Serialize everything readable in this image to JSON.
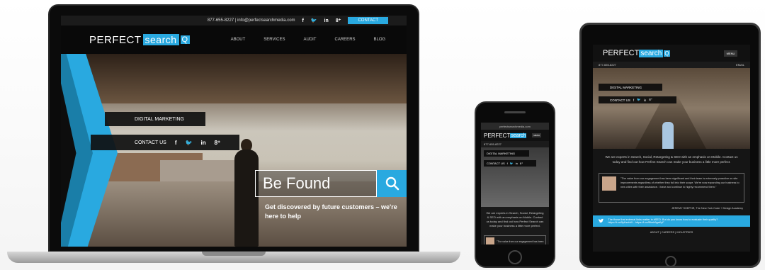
{
  "laptop": {
    "topbar": {
      "phone_email": "877-655-8227 | info@perfectsearchmedia.com",
      "social": [
        "f",
        "🐦",
        "in",
        "8⁺"
      ],
      "contact": "CONTACT"
    },
    "logo": {
      "word1": "PERFECT",
      "word2": "search",
      "q": "Q"
    },
    "nav": [
      "ABOUT",
      "SERVICES",
      "AUDIT",
      "CAREERS",
      "BLOG"
    ],
    "hero": {
      "digital_marketing": "DIGITAL MARKETING",
      "contact_us": "CONTACT US",
      "social": [
        "f",
        "🐦",
        "in",
        "8⁺"
      ],
      "search_text": "Be Found",
      "tagline": "Get discovered by future customers – we're here to help"
    }
  },
  "phone": {
    "url": "perfectsearchmedia.com",
    "logo": {
      "word1": "PERFECT",
      "word2": "search"
    },
    "menu": "MENU",
    "phone_number": "877-655-8227",
    "digital_marketing": "DIGITAL MARKETING",
    "contact_us": "CONTACT US",
    "social": [
      "f",
      "🐦",
      "in",
      "8⁺"
    ],
    "intro": "We are experts in Search, Social, Retargeting & SEO with an emphasis on Mobile. Contact us today and find out how Perfect Search can make your business a little more perfect.",
    "quote": "\"The value from our engagement has been"
  },
  "tablet": {
    "logo": {
      "word1": "PERFECT",
      "word2": "search",
      "q": "Q"
    },
    "menu": "MENU",
    "phone_number": "877-655-8227",
    "email": "EMAIL",
    "digital_marketing": "DIGITAL MARKETING",
    "contact_us": "CONTACT US",
    "social": [
      "f",
      "🐦",
      "in",
      "8⁺"
    ],
    "intro": "We are experts in Search, Social, Retargeting & SEO with an emphasis on Mobile. Contact us today and find out how Perfect Search can make your business a little more perfect.",
    "quote": "\"The value from our engagement has been significant and their team is extremely proactive on site improvements regardless of whether they fall into their scope. We're now expanding our business to new cities with their assistance. I have and continue to highly recommend them.\"",
    "author": "JEREMY SHEPHR, The New York Code + Design Academy",
    "twitter_text": "The those that external links matter in #SEO. But do you know how to evaluate their quality? https://t.co/5yKsxhW... https://t.co/Bheb9gaKyF",
    "footer": "ABOUT | CAREERS | INDUSTRIES"
  },
  "colors": {
    "accent": "#29a9e0",
    "accent_dark": "#1a7ea8",
    "bar": "#0f0f0f"
  }
}
